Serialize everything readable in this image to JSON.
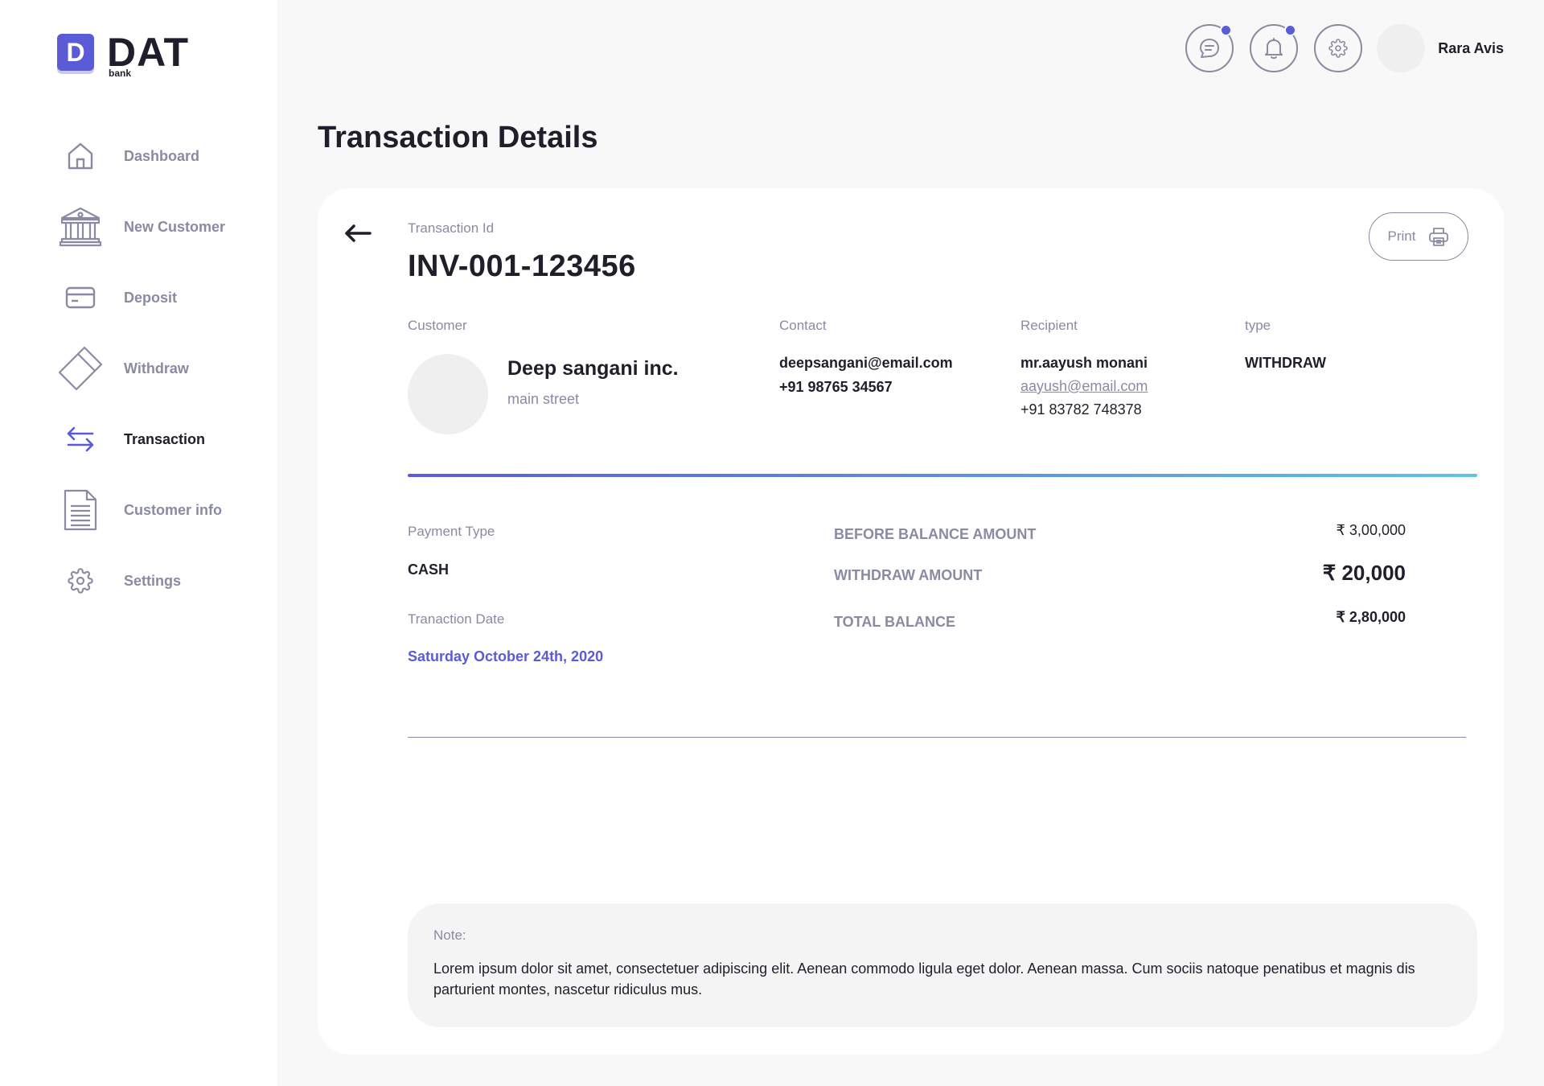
{
  "brand": {
    "mark": "D",
    "name": "DAT",
    "sub": "bank"
  },
  "sidebar": {
    "items": [
      {
        "label": "Dashboard",
        "icon": "home-icon",
        "active": false
      },
      {
        "label": "New Customer",
        "icon": "bank-icon",
        "active": false
      },
      {
        "label": "Deposit",
        "icon": "card-icon",
        "active": false
      },
      {
        "label": "Withdraw",
        "icon": "tag-icon",
        "active": false
      },
      {
        "label": "Transaction",
        "icon": "transfer-arrows-icon",
        "active": true
      },
      {
        "label": "Customer info",
        "icon": "document-icon",
        "active": false
      },
      {
        "label": "Settings",
        "icon": "gear-icon",
        "active": false
      }
    ]
  },
  "header": {
    "user_name": "Rara Avis"
  },
  "page": {
    "title": "Transaction Details"
  },
  "transaction": {
    "id_label": "Transaction Id",
    "id": "INV-001-123456",
    "print_label": "Print",
    "customer_label": "Customer",
    "customer_name": "Deep sangani inc.",
    "customer_address": "main street",
    "contact_label": "Contact",
    "contact_email": "deepsangani@email.com",
    "contact_phone": "+91 98765 34567",
    "recipient_label": "Recipient",
    "recipient_name": "mr.aayush monani",
    "recipient_email": "aayush@email.com",
    "recipient_phone": "+91 83782 748378",
    "type_label": "type",
    "type_value": "WITHDRAW",
    "payment_type_label": "Payment Type",
    "payment_type": "CASH",
    "date_label": "Tranaction Date",
    "date_value": "Saturday October 24th, 2020",
    "before_balance_label": "BEFORE BALANCE AMOUNT",
    "before_balance": "₹ 3,00,000",
    "withdraw_label": "WITHDRAW AMOUNT",
    "withdraw_amount": "₹ 20,000",
    "total_label": "TOTAL BALANCE",
    "total_balance": "₹ 2,80,000"
  },
  "note": {
    "label": "Note:",
    "text": "Lorem ipsum dolor sit amet, consectetuer adipiscing elit. Aenean commodo ligula eget dolor. Aenean massa. Cum sociis natoque penatibus et magnis dis parturient montes, nascetur ridiculus mus."
  },
  "colors": {
    "accent": "#5b5bd6",
    "muted": "#8a8aa3",
    "text": "#1f1f2b",
    "gradient_end": "#5fc3e4"
  }
}
